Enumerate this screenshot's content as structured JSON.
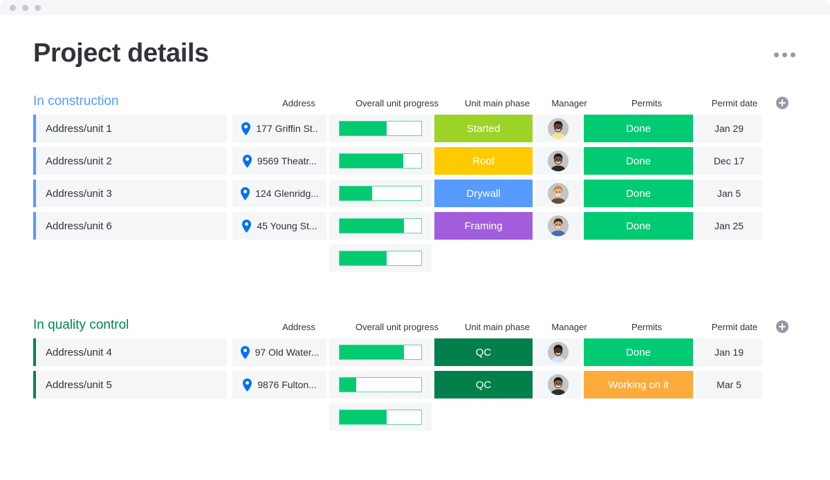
{
  "window": {
    "traffic_lights": [
      "dot",
      "dot",
      "dot"
    ]
  },
  "header": {
    "title": "Project details",
    "menu_icon": "kebab-menu-icon"
  },
  "column_headers": {
    "address": "Address",
    "progress": "Overall unit progress",
    "phase": "Unit main phase",
    "manager": "Manager",
    "permits": "Permits",
    "date": "Permit date",
    "add": "add-column-icon"
  },
  "colors": {
    "group_construction": "#579bfc",
    "group_quality": "#00854d",
    "progress_fill": "#00ca72",
    "progress_border": "#5ad897",
    "done": "#00ca72",
    "working_on_it": "#fdab3d",
    "phase_started": "#9cd326",
    "phase_roof": "#ffcb00",
    "phase_drywall": "#579bfc",
    "phase_framing": "#a25ddc",
    "phase_qc": "#037f4c",
    "row_bg": "#f5f6f8",
    "text": "#323338"
  },
  "groups": [
    {
      "title": "In construction",
      "accent": "#579bfc",
      "rows": [
        {
          "name": "Address/unit 1",
          "address": "177 Griffin St..",
          "progress": 58,
          "phase": {
            "label": "Started",
            "color": "#9cd326"
          },
          "manager": {
            "name": "manager-avatar",
            "skin": "#6b4433",
            "hair": "#201a18",
            "shirt": "#f5e98e"
          },
          "permit": {
            "label": "Done",
            "color": "#00ca72"
          },
          "date": "Jan 29"
        },
        {
          "name": "Address/unit 2",
          "address": "9569 Theatr...",
          "progress": 78,
          "phase": {
            "label": "Roof",
            "color": "#ffcb00"
          },
          "manager": {
            "name": "manager-avatar",
            "skin": "#7a5238",
            "hair": "#1c1411",
            "shirt": "#2b2b2b"
          },
          "permit": {
            "label": "Done",
            "color": "#00ca72"
          },
          "date": "Dec 17"
        },
        {
          "name": "Address/unit 3",
          "address": "124 Glenridg...",
          "progress": 40,
          "phase": {
            "label": "Drywall",
            "color": "#579bfc"
          },
          "manager": {
            "name": "manager-avatar",
            "skin": "#e8b89a",
            "hair": "#c08a4e",
            "shirt": "#6b4a38"
          },
          "permit": {
            "label": "Done",
            "color": "#00ca72"
          },
          "date": "Jan 5"
        },
        {
          "name": "Address/unit 6",
          "address": "45 Young St...",
          "progress": 79,
          "phase": {
            "label": "Framing",
            "color": "#a25ddc"
          },
          "manager": {
            "name": "manager-avatar",
            "skin": "#d9a077",
            "hair": "#3a2a1e",
            "shirt": "#3f6fb5"
          },
          "permit": {
            "label": "Done",
            "color": "#00ca72"
          },
          "date": "Jan 25"
        }
      ],
      "summary_progress": 58
    },
    {
      "title": "In quality control",
      "accent": "#00854d",
      "rows": [
        {
          "name": "Address/unit 4",
          "address": "97 Old Water...",
          "progress": 79,
          "phase": {
            "label": "QC",
            "color": "#037f4c"
          },
          "manager": {
            "name": "manager-avatar",
            "skin": "#4e3224",
            "hair": "#14100e",
            "shirt": "#dfe3ef"
          },
          "permit": {
            "label": "Done",
            "color": "#00ca72"
          },
          "date": "Jan 19"
        },
        {
          "name": "Address/unit 5",
          "address": "9876 Fulton...",
          "progress": 20,
          "phase": {
            "label": "QC",
            "color": "#037f4c"
          },
          "manager": {
            "name": "manager-avatar",
            "skin": "#8a6242",
            "hair": "#1b1512",
            "shirt": "#2e2e2e"
          },
          "permit": {
            "label": "Working on it",
            "color": "#fdab3d"
          },
          "date": "Mar 5"
        }
      ],
      "summary_progress": 58
    }
  ]
}
